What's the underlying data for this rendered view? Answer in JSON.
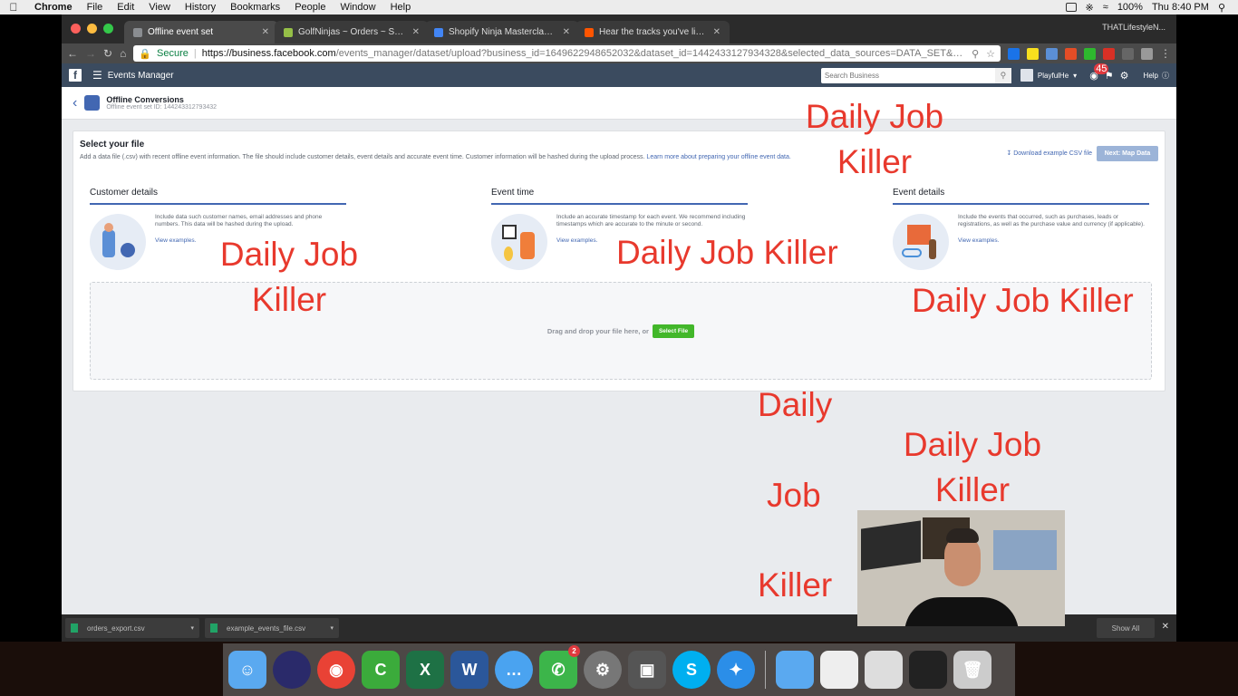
{
  "menubar": {
    "app": "Chrome",
    "items": [
      "File",
      "Edit",
      "View",
      "History",
      "Bookmarks",
      "People",
      "Window",
      "Help"
    ],
    "battery": "100%",
    "clock": "Thu 8:40 PM"
  },
  "chrome": {
    "profile": "THATLifestyleN...",
    "tabs": [
      {
        "title": "Offline event set",
        "color": "#8a8d91"
      },
      {
        "title": "GolfNinjas ~ Orders ~ Shopify",
        "color": "#95bf47"
      },
      {
        "title": "Shopify Ninja Masterclass! (Fi",
        "color": "#4285f4"
      },
      {
        "title": "Hear the tracks you've liked: o",
        "color": "#ff5500"
      }
    ],
    "url": {
      "secure_label": "Secure",
      "host": "https://business.facebook.com",
      "path": "/events_manager/dataset/upload?business_id=1649622948652032&dataset_id=1442433127934328&selected_data_sources=DATA_SET&s..."
    }
  },
  "fb": {
    "logo": "f",
    "section": "Events Manager",
    "search_placeholder": "Search Business",
    "account": "PlayfulHe",
    "notif_count": "45",
    "help": "Help"
  },
  "page": {
    "title": "Offline Conversions",
    "subtitle": "Offline event set ID: 144243312793432",
    "card_title": "Select your file",
    "card_desc": "Add a data file (.csv) with recent offline event information. The file should include customer details, event details and accurate event time. Customer information will be hashed during the upload process.",
    "learn_more": "Learn more about preparing your offline event data.",
    "download_link": "Download example CSV file",
    "next_button": "Next: Map Data",
    "columns": [
      {
        "title": "Customer details",
        "text": "Include data such customer names, email addresses and phone numbers. This data will be hashed during the upload.",
        "link": "View examples."
      },
      {
        "title": "Event time",
        "text": "Include an accurate timestamp for each event. We recommend including timestamps which are accurate to the minute or second.",
        "link": "View examples."
      },
      {
        "title": "Event details",
        "text": "Include the events that occurred, such as purchases, leads or registrations, as well as the purchase value and currency (if applicable).",
        "link": "View examples."
      }
    ],
    "dropzone_text": "Drag and drop your file here, or",
    "select_file": "Select File"
  },
  "downloads": {
    "items": [
      "orders_export.csv",
      "example_events_file.csv"
    ],
    "show_all": "Show All"
  },
  "overlays": {
    "o1": "Daily Job\nKiller",
    "o2": "Daily Job\nKiller",
    "o3": "Daily Job Killer",
    "o4": "Daily Job Killer",
    "o5a": "Daily",
    "o5b": "Job",
    "o5c": "Killer",
    "o6": "Daily Job\nKiller"
  },
  "dock": {
    "badge": "2"
  }
}
